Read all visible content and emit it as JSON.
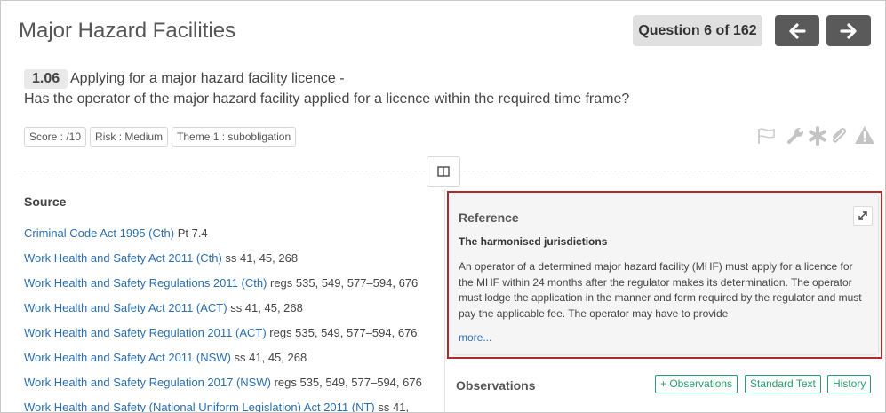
{
  "header": {
    "title": "Major Hazard Facilities",
    "question_counter": "Question 6 of 162",
    "prev_icon": "arrow-left-icon",
    "next_icon": "arrow-right-icon"
  },
  "question": {
    "number": "1.06",
    "topic": "Applying for a major hazard facility licence -",
    "text": "Has the operator of the major hazard facility applied for a licence within the required time frame?",
    "tags": [
      "Score : /10",
      "Risk : Medium",
      "Theme 1 : subobligation"
    ]
  },
  "tools": [
    "flag-icon",
    "wrench-icon",
    "asterisk-icon",
    "paperclip-icon",
    "warning-icon"
  ],
  "source": {
    "heading": "Source",
    "items": [
      {
        "link": "Criminal Code Act 1995 (Cth)",
        "suffix": " Pt 7.4"
      },
      {
        "link": "Work Health and Safety Act 2011 (Cth)",
        "suffix": " ss 41, 45, 268"
      },
      {
        "link": "Work Health and Safety Regulations 2011 (Cth)",
        "suffix": " regs 535, 549, 577–594, 676"
      },
      {
        "link": "Work Health and Safety Act 2011 (ACT)",
        "suffix": " ss 41, 45, 268"
      },
      {
        "link": "Work Health and Safety Regulation 2011 (ACT)",
        "suffix": " regs 535, 549, 577–594, 676"
      },
      {
        "link": "Work Health and Safety Act 2011 (NSW)",
        "suffix": " ss 41, 45, 268"
      },
      {
        "link": "Work Health and Safety Regulation 2017 (NSW)",
        "suffix": " regs 535, 549, 577–594, 676"
      },
      {
        "link": "Work Health and Safety (National Uniform Legislation) Act 2011 (NT)",
        "suffix": " ss 41,"
      }
    ]
  },
  "reference": {
    "heading": "Reference",
    "subtitle": "The harmonised jurisdictions",
    "body": "An operator of a determined major hazard facility (MHF) must apply for a licence for the MHF within 24 months after the regulator makes its determination. The operator must lodge the application in the manner and form required by the regulator and must pay the applicable fee. The operator may have to provide",
    "more": "more...",
    "expand_icon": "expand-icon"
  },
  "observations": {
    "heading": "Observations",
    "buttons": [
      "+ Observations",
      "Standard Text",
      "History"
    ]
  },
  "colors": {
    "link": "#2a6fb0",
    "green": "#2a9d6e",
    "highlight_border": "#b02a2a",
    "nav_button": "#5a5a5a"
  }
}
